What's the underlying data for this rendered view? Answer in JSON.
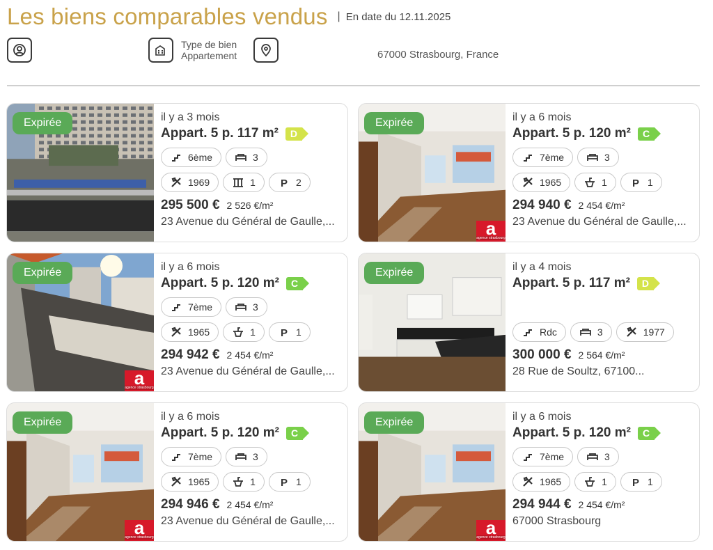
{
  "header": {
    "title": "Les biens comparables vendus",
    "separator": "|",
    "date_label": "En date du 12.11.2025"
  },
  "filters": {
    "type_label": "Type de bien",
    "type_value": "Appartement",
    "address": "67000 Strasbourg, France",
    "icons": [
      "user-icon",
      "building-icon",
      "location-pin-icon"
    ]
  },
  "dpe_colors": {
    "C": "#7ad04a",
    "D": "#d4e34a"
  },
  "listings": [
    {
      "badge": "Expirée",
      "ago": "il y a 3 mois",
      "title": "Appart. 5 p. 117 m²",
      "dpe": "D",
      "row1": [
        {
          "icon": "stairs-icon",
          "text": "6ème"
        },
        {
          "icon": "bed-icon",
          "text": "3"
        }
      ],
      "row2": [
        {
          "icon": "tools-icon",
          "text": "1969"
        },
        {
          "icon": "columns-icon",
          "text": "1"
        },
        {
          "icon": "parking-icon",
          "text": "2"
        }
      ],
      "price": "295 500 €",
      "ppm": "2 526 €/m²",
      "address": "23 Avenue du Général de Gaulle,...",
      "logo": false
    },
    {
      "badge": "Expirée",
      "ago": "il y a 6 mois",
      "title": "Appart. 5 p. 120 m²",
      "dpe": "C",
      "row1": [
        {
          "icon": "stairs-icon",
          "text": "7ème"
        },
        {
          "icon": "bed-icon",
          "text": "3"
        }
      ],
      "row2": [
        {
          "icon": "tools-icon",
          "text": "1965"
        },
        {
          "icon": "sink-icon",
          "text": "1"
        },
        {
          "icon": "parking-icon",
          "text": "1"
        }
      ],
      "price": "294 940 €",
      "ppm": "2 454 €/m²",
      "address": "23 Avenue du Général de Gaulle,...",
      "logo": true
    },
    {
      "badge": "Expirée",
      "ago": "il y a 6 mois",
      "title": "Appart. 5 p. 120 m²",
      "dpe": "C",
      "row1": [
        {
          "icon": "stairs-icon",
          "text": "7ème"
        },
        {
          "icon": "bed-icon",
          "text": "3"
        }
      ],
      "row2": [
        {
          "icon": "tools-icon",
          "text": "1965"
        },
        {
          "icon": "sink-icon",
          "text": "1"
        },
        {
          "icon": "parking-icon",
          "text": "1"
        }
      ],
      "price": "294 942 €",
      "ppm": "2 454 €/m²",
      "address": "23 Avenue du Général de Gaulle,...",
      "logo": true
    },
    {
      "badge": "Expirée",
      "ago": "il y a 4 mois",
      "title": "Appart. 5 p. 117 m²",
      "dpe": "D",
      "row1": [],
      "row2": [
        {
          "icon": "stairs-icon",
          "text": "Rdc"
        },
        {
          "icon": "bed-icon",
          "text": "3"
        },
        {
          "icon": "tools-icon",
          "text": "1977"
        }
      ],
      "price": "300 000 €",
      "ppm": "2 564 €/m²",
      "address": "28 Rue de Soultz, 67100...",
      "logo": false
    },
    {
      "badge": "Expirée",
      "ago": "il y a 6 mois",
      "title": "Appart. 5 p. 120 m²",
      "dpe": "C",
      "row1": [
        {
          "icon": "stairs-icon",
          "text": "7ème"
        },
        {
          "icon": "bed-icon",
          "text": "3"
        }
      ],
      "row2": [
        {
          "icon": "tools-icon",
          "text": "1965"
        },
        {
          "icon": "sink-icon",
          "text": "1"
        },
        {
          "icon": "parking-icon",
          "text": "1"
        }
      ],
      "price": "294 946 €",
      "ppm": "2 454 €/m²",
      "address": "23 Avenue du Général de Gaulle,...",
      "logo": true
    },
    {
      "badge": "Expirée",
      "ago": "il y a 6 mois",
      "title": "Appart. 5 p. 120 m²",
      "dpe": "C",
      "row1": [
        {
          "icon": "stairs-icon",
          "text": "7ème"
        },
        {
          "icon": "bed-icon",
          "text": "3"
        }
      ],
      "row2": [
        {
          "icon": "tools-icon",
          "text": "1965"
        },
        {
          "icon": "sink-icon",
          "text": "1"
        },
        {
          "icon": "parking-icon",
          "text": "1"
        }
      ],
      "price": "294 944 €",
      "ppm": "2 454 €/m²",
      "address": "67000 Strasbourg",
      "logo": true
    }
  ],
  "logo_text": {
    "letter": "a",
    "caption": "agence strasbourg"
  }
}
